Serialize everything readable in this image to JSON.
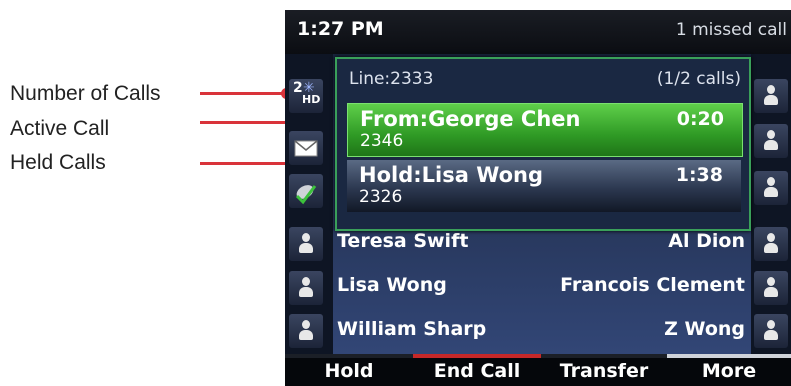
{
  "annotations": [
    {
      "label": "Number of Calls"
    },
    {
      "label": "Active Call"
    },
    {
      "label": "Held Calls"
    }
  ],
  "status_bar": {
    "time": "1:27 PM",
    "notice": "1 missed call"
  },
  "call_count_badge": {
    "count": "2",
    "hd": "HD"
  },
  "call_panel": {
    "line": "Line:2333",
    "count": "(1/2 calls)",
    "active": {
      "name": "From:George Chen",
      "number": "2346",
      "duration": "0:20"
    },
    "held": {
      "name": "Hold:Lisa Wong",
      "number": "2326",
      "duration": "1:38"
    }
  },
  "contacts": [
    {
      "left": "Teresa Swift",
      "right": "Al Dion"
    },
    {
      "left": "Lisa Wong",
      "right": "Francois Clement"
    },
    {
      "left": "William Sharp",
      "right": "Z Wong"
    }
  ],
  "softkeys": [
    "Hold",
    "End Call",
    "Transfer",
    "More"
  ],
  "colors": {
    "annotation": "#d9333a",
    "active_call": "#3fb131",
    "end_call_accent": "#c62828"
  }
}
